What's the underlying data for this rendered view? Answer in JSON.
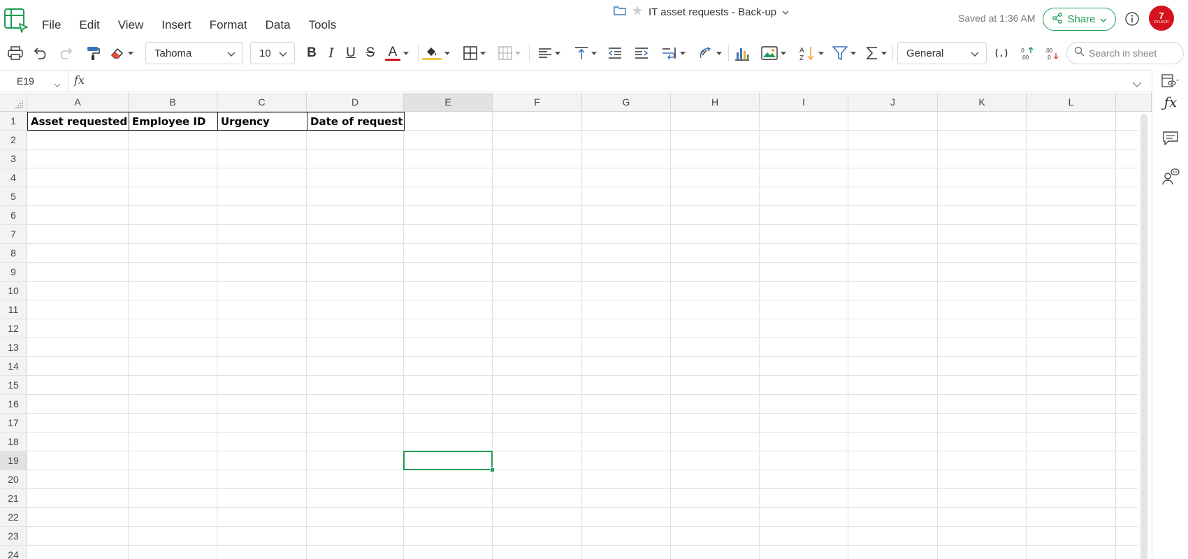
{
  "app": {
    "logo_icon": "zoho-sheet-logo-icon"
  },
  "menu": [
    "File",
    "Edit",
    "View",
    "Insert",
    "Format",
    "Data",
    "Tools"
  ],
  "document": {
    "title": "IT asset requests - Back-up",
    "saved_status": "Saved at 1:36 AM",
    "share_label": "Share"
  },
  "user": {
    "avatar_text": "7",
    "avatar_sub": "ZYLKER",
    "avatar_color": "#d6121f"
  },
  "toolbar": {
    "font_family": "Tahoma",
    "font_size": "10",
    "number_format": "General",
    "search_placeholder": "Search in sheet",
    "bold": "B",
    "italic": "I",
    "underline": "U",
    "strike": "S",
    "font_color_letter": "A",
    "font_color": "#d6121f",
    "fill_color": "#f2c94c"
  },
  "formula_bar": {
    "cell_ref": "E19",
    "fx_label": "fx",
    "formula": ""
  },
  "accent_color": "#1f9d55",
  "sheet": {
    "columns": [
      "A",
      "B",
      "C",
      "D",
      "E",
      "F",
      "G",
      "H",
      "I",
      "J",
      "K",
      "L"
    ],
    "rows": [
      "1",
      "2",
      "3",
      "4",
      "5",
      "6",
      "7",
      "8",
      "9",
      "10",
      "11",
      "12",
      "13",
      "14",
      "15",
      "16",
      "17",
      "18",
      "19",
      "20",
      "21",
      "22",
      "23",
      "24"
    ],
    "header_row": [
      "Asset requested",
      "Employee ID",
      "Urgency",
      "Date of request"
    ],
    "active_cell": {
      "column": "E",
      "row": "19"
    }
  }
}
